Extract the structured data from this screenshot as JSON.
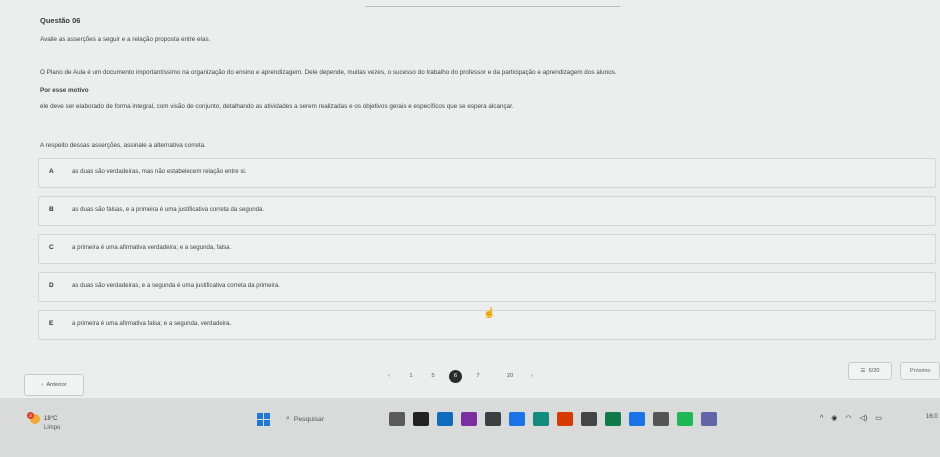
{
  "question": {
    "title": "Questão 06",
    "instruction": "Avalie as asserções a seguir e a relação proposta entre elas.",
    "assertion1": "O Plano de Aula é um documento importantíssimo na organização do ensino e aprendizagem. Dele depende, muitas vezes, o sucesso do trabalho do professor e da participação e aprendizagem dos alunos.",
    "connector": "Por esse motivo",
    "assertion2": "ele deve ser elaborado de forma integral, com visão de conjunto, detalhando as atividades a serem realizadas e os objetivos gerais e específicos que se espera alcançar.",
    "prompt": "A respeito dessas asserções, assinale a alternativa correta."
  },
  "options": [
    {
      "letter": "A",
      "text": "as duas são verdadeiras, mas não estabelecem relação entre si."
    },
    {
      "letter": "B",
      "text": "as duas são falsas, e a primeira é uma justificativa correta da segunda."
    },
    {
      "letter": "C",
      "text": "a primeira é uma afirmativa verdadeira; e a segunda, falsa."
    },
    {
      "letter": "D",
      "text": "as duas são verdadeiras, e a segunda é uma justificativa correta da primeira."
    },
    {
      "letter": "E",
      "text": "a primeira é uma afirmativa falsa; e a segunda, verdadeira."
    }
  ],
  "nav": {
    "prev_label": "Anterior",
    "prev_arrow": "‹",
    "pager_prev": "‹",
    "pager_next": "›",
    "pages": [
      "1",
      "5",
      "6",
      "7",
      "20"
    ],
    "active_page": "6",
    "counter": "6/20",
    "next_label": "Próximo"
  },
  "taskbar": {
    "weather_badge": "2",
    "temperature": "18°C",
    "condition": "Limpo",
    "search_placeholder": "Pesquisar",
    "clock": "16:0",
    "app_colors": [
      "#5a5a5a",
      "#222222",
      "#0f6cbd",
      "#7a2ea0",
      "#3a3f44",
      "#1a73e8",
      "#128c7e",
      "#d83b01",
      "#444444",
      "#0f7b4a",
      "#1a73e8",
      "#555555",
      "#1db954",
      "#6264a7"
    ]
  }
}
